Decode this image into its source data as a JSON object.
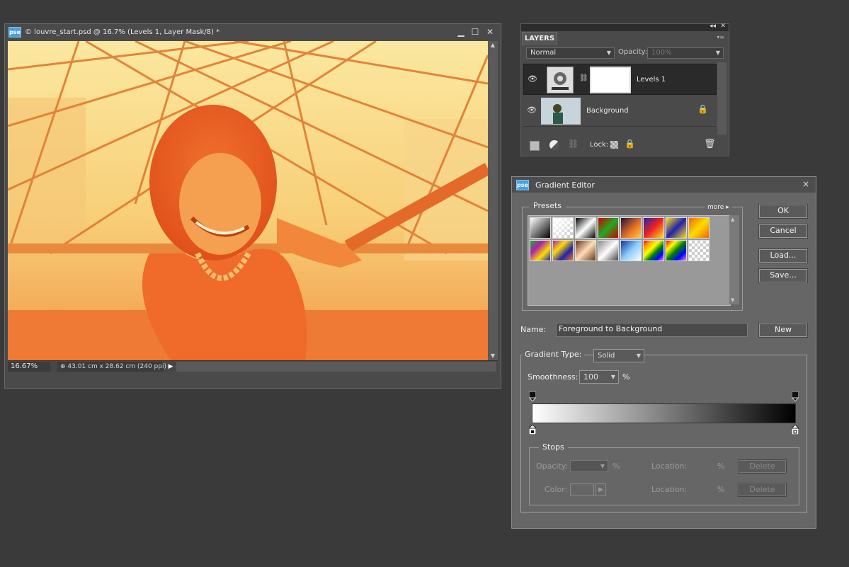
{
  "document": {
    "title": "© louvre_start.psd @ 16.7% (Levels 1, Layer Mask/8) *",
    "app_badge": "pse",
    "zoom": "16.67%",
    "doc_info": "⊕ 43.01 cm x 28.62 cm (240 ppi)",
    "controls": {
      "minimize": "▁",
      "maximize": "☐",
      "close": "✕"
    }
  },
  "layers_panel": {
    "tab": "LAYERS",
    "blend_mode": "Normal",
    "opacity_label": "Opacity:",
    "opacity_value": "100%",
    "layers": [
      {
        "name": "Levels 1",
        "selected": true
      },
      {
        "name": "Background",
        "locked": true
      }
    ],
    "lock_label": "Lock:"
  },
  "gradient_editor": {
    "title": "Gradient Editor",
    "app_badge": "pse",
    "presets_label": "Presets",
    "more_label": "more",
    "buttons": {
      "ok": "OK",
      "cancel": "Cancel",
      "load": "Load...",
      "save": "Save...",
      "new": "New"
    },
    "name_label": "Name:",
    "name_value": "Foreground to Background",
    "gradient_type_label": "Gradient Type:",
    "gradient_type_value": "Solid",
    "smoothness_label": "Smoothness:",
    "smoothness_value": "100",
    "smoothness_unit": "%",
    "stops": {
      "label": "Stops",
      "opacity_label": "Opacity:",
      "opacity_unit": "%",
      "color_label": "Color:",
      "location_label": "Location:",
      "location_unit": "%",
      "delete_label": "Delete"
    }
  }
}
